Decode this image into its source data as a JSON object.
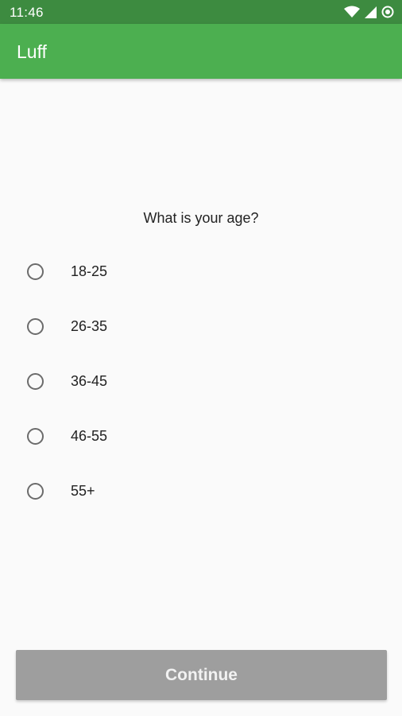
{
  "status_bar": {
    "time": "11:46",
    "icons": [
      "wifi-icon",
      "cell-signal-icon",
      "sync-icon"
    ]
  },
  "app_bar": {
    "title": "Luff",
    "color": "#4caf50"
  },
  "survey": {
    "question": "What is your age?",
    "options": [
      {
        "label": "18-25",
        "selected": false
      },
      {
        "label": "26-35",
        "selected": false
      },
      {
        "label": "36-45",
        "selected": false
      },
      {
        "label": "46-55",
        "selected": false
      },
      {
        "label": "55+",
        "selected": false
      }
    ]
  },
  "footer": {
    "continue_label": "Continue",
    "continue_enabled": false
  }
}
